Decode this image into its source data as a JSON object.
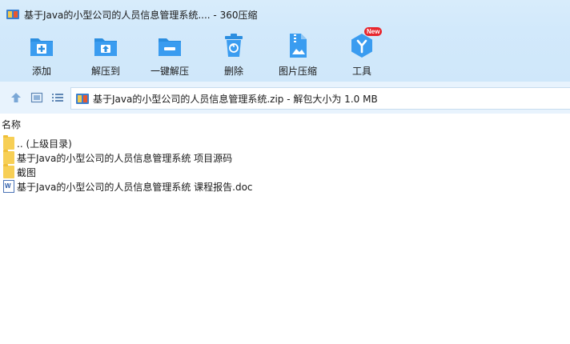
{
  "window": {
    "title": "基于Java的小型公司的人员信息管理系统.... - 360压缩"
  },
  "toolbar": {
    "items": [
      {
        "label": "添加",
        "icon": "add-icon"
      },
      {
        "label": "解压到",
        "icon": "extract-to-icon"
      },
      {
        "label": "一键解压",
        "icon": "one-click-extract-icon"
      },
      {
        "label": "删除",
        "icon": "trash-icon"
      },
      {
        "label": "图片压缩",
        "icon": "image-compress-icon"
      },
      {
        "label": "工具",
        "icon": "tools-icon",
        "badge": "New"
      }
    ],
    "accent": "#2b8ee0"
  },
  "address": {
    "path": "基于Java的小型公司的人员信息管理系统.zip - 解包大小为 1.0 MB"
  },
  "list": {
    "column_name": "名称",
    "rows": [
      {
        "name": ".. (上级目录)",
        "type": "folder"
      },
      {
        "name": "基于Java的小型公司的人员信息管理系统 项目源码",
        "type": "folder"
      },
      {
        "name": "截图",
        "type": "folder"
      },
      {
        "name": "基于Java的小型公司的人员信息管理系统 课程报告.doc",
        "type": "doc"
      }
    ]
  }
}
